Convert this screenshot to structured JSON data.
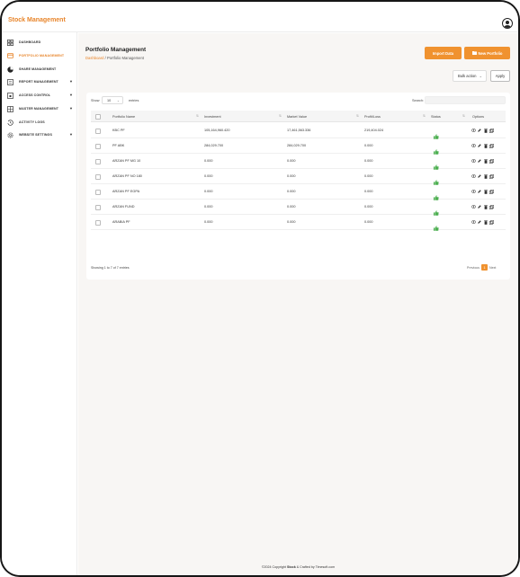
{
  "app": {
    "brand": "Stock Management"
  },
  "sidebar": {
    "items": [
      {
        "label": "DASHBOARD",
        "icon": "dashboard-icon",
        "active": false,
        "has_caret": false
      },
      {
        "label": "PORTFOLIO MANAGEMENT",
        "icon": "folder-icon",
        "active": true,
        "has_caret": false
      },
      {
        "label": "SHARE MANAGEMENT",
        "icon": "pie-chart-icon",
        "active": false,
        "has_caret": false
      },
      {
        "label": "REPORT MANAGEMENT",
        "icon": "report-icon",
        "active": false,
        "has_caret": true
      },
      {
        "label": "ACCESS CONTROL",
        "icon": "lock-icon",
        "active": false,
        "has_caret": true
      },
      {
        "label": "MASTER MANAGEMENT",
        "icon": "grid-icon",
        "active": false,
        "has_caret": true
      },
      {
        "label": "ACTIVITY LOGS",
        "icon": "history-icon",
        "active": false,
        "has_caret": false
      },
      {
        "label": "WEBSITE SETTINGS",
        "icon": "settings-icon",
        "active": false,
        "has_caret": true
      }
    ]
  },
  "page": {
    "title": "Portfolio Management",
    "breadcrumb_link": "Dashboard",
    "breadcrumb_sep": " / ",
    "breadcrumb_current": "Portfolio Management",
    "import_label": "Import Data",
    "new_label": "New Portfolio",
    "bulk_label": "Bulk action",
    "apply_label": "Apply"
  },
  "table": {
    "show_label": "Show",
    "entries_value": "10",
    "entries_label": "entries",
    "search_label": "Search:",
    "columns": [
      "Portfolio Name",
      "Investment",
      "Market Value",
      "Profit/Loss",
      "Status",
      "Options"
    ],
    "rows": [
      [
        "KBC PF",
        "105,164,960.420",
        "17,461,563.336",
        "219,404.024"
      ],
      [
        "PF ABK",
        "284,029.700",
        "284,029.700",
        "0.000"
      ],
      [
        "ARZAN PF MG 10",
        "0.000",
        "0.000",
        "0.000"
      ],
      [
        "ARZAN PF NO 180",
        "0.000",
        "0.000",
        "0.000"
      ],
      [
        "ARZAN PF EGPA",
        "0.000",
        "0.000",
        "0.000"
      ],
      [
        "ARZAN FUND",
        "0.000",
        "0.000",
        "0.000"
      ],
      [
        "ARABIA PF",
        "0.000",
        "0.000",
        "0.000"
      ]
    ],
    "info": "Showing 1 to 7 of 7 entries",
    "prev_label": "Previous",
    "current_page": "1",
    "next_label": "Next"
  },
  "footer": {
    "prefix": "©2024 Copyright ",
    "brand": "Stock",
    "suffix": " & Crafted by Timesoft.com"
  },
  "colors": {
    "accent": "#f0922f",
    "brand": "#e8852b",
    "status_green": "#4caf50"
  }
}
